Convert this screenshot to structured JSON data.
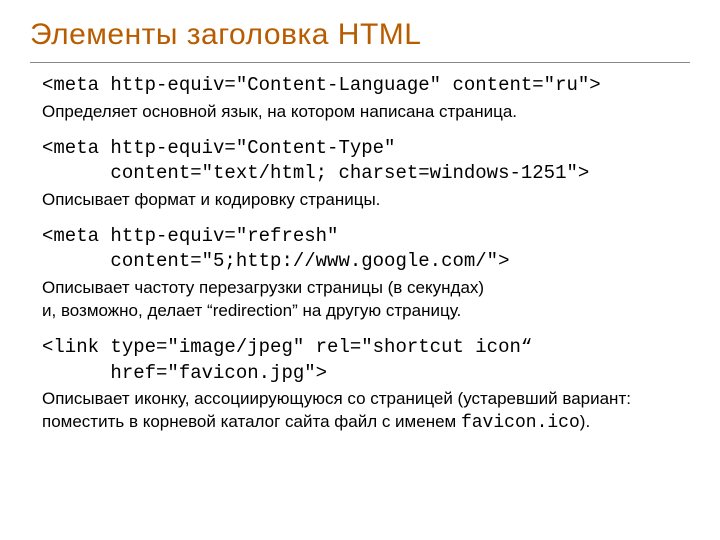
{
  "title": "Элементы заголовка HTML",
  "blocks": [
    {
      "code": "<meta http-equiv=\"Content-Language\" content=\"ru\">",
      "desc": "Определяет основной язык, на котором написана страница."
    },
    {
      "code": "<meta http-equiv=\"Content-Type\"\n      content=\"text/html; charset=windows-1251\">",
      "desc": "Описывает формат и кодировку страницы."
    },
    {
      "code": "<meta http-equiv=\"refresh\"\n      content=\"5;http://www.google.com/\">",
      "desc": "Описывает частоту перезагрузки страницы (в секундах)\nи, возможно, делает “redirection” на другую страницу."
    },
    {
      "code": "<link type=\"image/jpeg\" rel=\"shortcut icon“\n      href=\"favicon.jpg\">",
      "desc_prefix": "Описывает иконку, ассоциирующуюся со страницей (устаревший вариант: поместить в корневой каталог сайта файл с именем ",
      "desc_mono": "favicon.ico",
      "desc_suffix": ")."
    }
  ]
}
